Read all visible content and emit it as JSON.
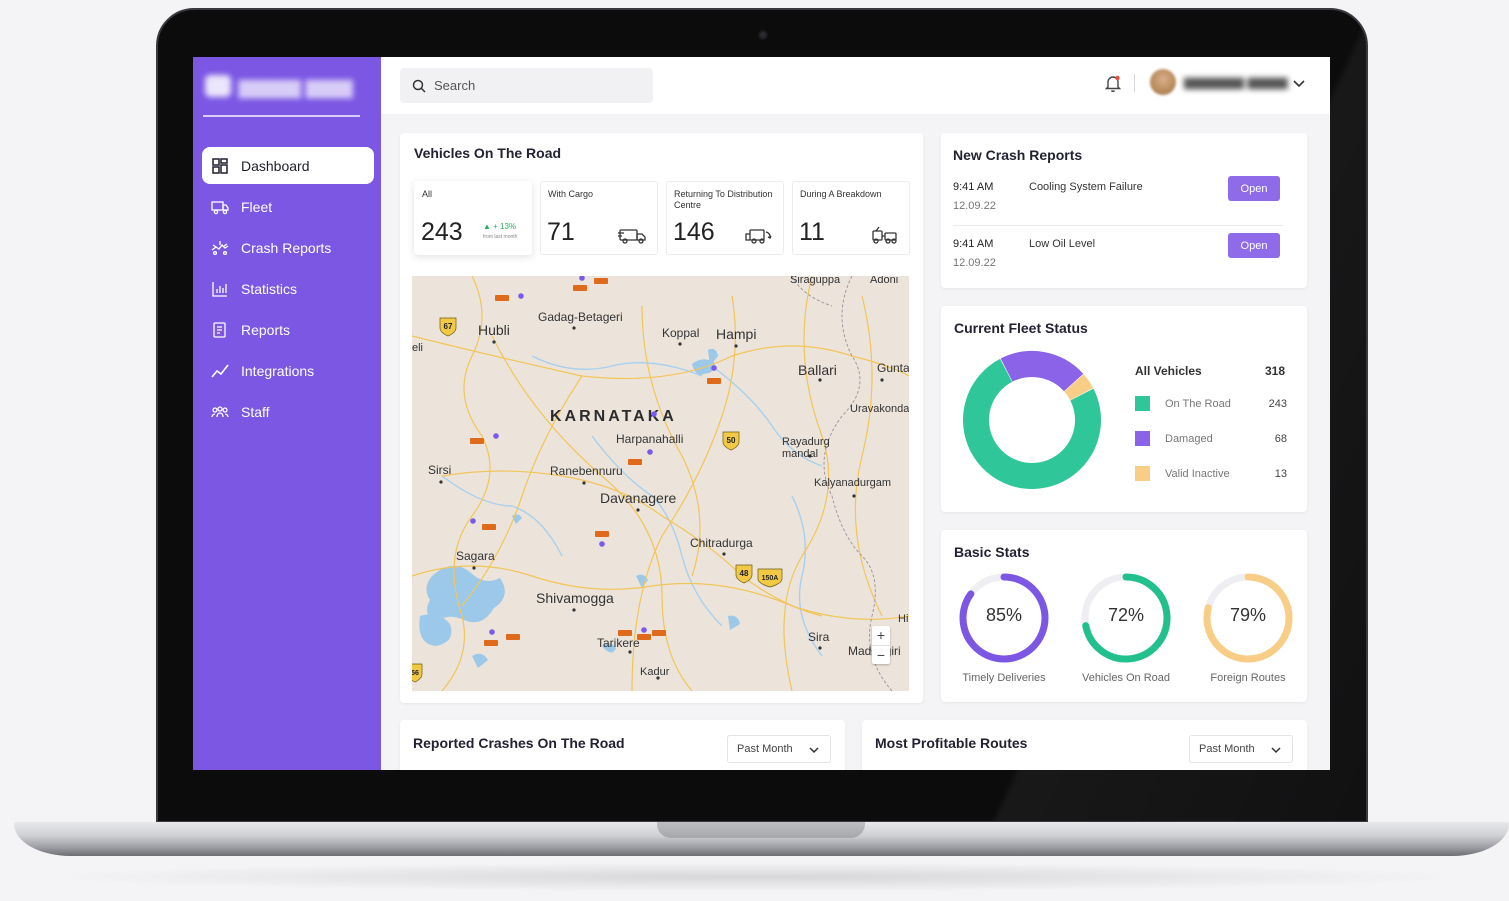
{
  "colors": {
    "sidebar": "#7b57e4",
    "accent": "#8f6bea",
    "on_road": "#2fc79a",
    "damaged": "#8b63e8",
    "valid_inactive": "#f8cd86",
    "timely": "#7b57e4",
    "vehicles_on_road": "#22c08c",
    "foreign": "#f8cd86"
  },
  "sidebar": {
    "items": [
      {
        "label": "Dashboard",
        "icon": "dashboard-icon",
        "active": true
      },
      {
        "label": "Fleet",
        "icon": "truck-icon"
      },
      {
        "label": "Crash Reports",
        "icon": "crash-icon"
      },
      {
        "label": "Statistics",
        "icon": "bar-chart-icon"
      },
      {
        "label": "Reports",
        "icon": "document-icon"
      },
      {
        "label": "Integrations",
        "icon": "line-chart-icon"
      },
      {
        "label": "Staff",
        "icon": "people-icon"
      }
    ]
  },
  "topbar": {
    "search_placeholder": "Search"
  },
  "vehicles": {
    "title": "Vehicles On The Road",
    "tiles": [
      {
        "label": "All",
        "value": "243",
        "trend": "+ 13%",
        "trend_sub": "from last month"
      },
      {
        "label": "With Cargo",
        "value": "71"
      },
      {
        "label": "Returning To Distribution Centre",
        "value": "146"
      },
      {
        "label": "During A Breakdown",
        "value": "11"
      }
    ]
  },
  "map": {
    "labels": {
      "siraguppa": "Siraguppa",
      "adoni": "Adoni",
      "hubli": "Hubli",
      "gadag": "Gadag-Betageri",
      "koppal": "Koppal",
      "hampi": "Hampi",
      "ballari": "Ballari",
      "gunta": "Gunta",
      "uravakonda": "Uravakonda",
      "karnataka": "KARNATAKA",
      "harpanahalli": "Harpanahalli",
      "rayadurg": "Rayadurg mandal",
      "sirsi": "Sirsi",
      "ranebennuru": "Ranebennuru",
      "davanagere": "Davanagere",
      "kalyandurgam": "Kalyanadurgam",
      "sagara": "Sagara",
      "chitradurga": "Chitradurga",
      "shivamogga": "Shivamogga",
      "tarikere": "Tarikere",
      "sira": "Sira",
      "madhugiri": "Madhugiri",
      "kadur": "Kadur",
      "eli": "eli",
      "hi": "Hi"
    },
    "shields": [
      "67",
      "50",
      "48",
      "150A",
      "56"
    ],
    "zoom_in": "+",
    "zoom_out": "−"
  },
  "crash_reports": {
    "title": "New Crash Reports",
    "rows": [
      {
        "time": "9:41 AM",
        "date": "12.09.22",
        "text": "Cooling System Failure",
        "button": "Open"
      },
      {
        "time": "9:41 AM",
        "date": "12.09.22",
        "text": "Low Oil Level",
        "button": "Open"
      }
    ]
  },
  "fleet_status": {
    "title": "Current Fleet Status",
    "total_label": "All Vehicles",
    "total_value": "318",
    "segments": [
      {
        "label": "On The Road",
        "value": 243
      },
      {
        "label": "Damaged",
        "value": 68
      },
      {
        "label": "Valid Inactive",
        "value": 13
      }
    ]
  },
  "basic_stats": {
    "title": "Basic Stats",
    "gauges": [
      {
        "label": "Timely Deliveries",
        "value": "85%",
        "percent": 85
      },
      {
        "label": "Vehicles On Road",
        "value": "72%",
        "percent": 72
      },
      {
        "label": "Foreign Routes",
        "value": "79%",
        "percent": 79
      }
    ]
  },
  "bottom": {
    "crashes_title": "Reported Crashes On The Road",
    "routes_title": "Most Profitable Routes",
    "period": "Past Month"
  }
}
